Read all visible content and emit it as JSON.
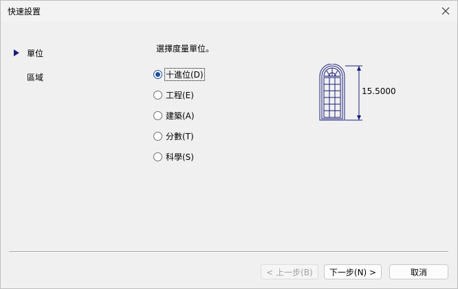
{
  "window": {
    "title": "快速設置"
  },
  "nav": {
    "items": [
      {
        "label": "單位",
        "active": true
      },
      {
        "label": "區域",
        "active": false
      }
    ]
  },
  "units": {
    "prompt": "選擇度量單位。",
    "options": [
      {
        "label": "十進位(D)",
        "checked": true
      },
      {
        "label": "工程(E)",
        "checked": false
      },
      {
        "label": "建築(A)",
        "checked": false
      },
      {
        "label": "分數(T)",
        "checked": false
      },
      {
        "label": "科學(S)",
        "checked": false
      }
    ],
    "preview_dimension": "15.5000"
  },
  "buttons": {
    "back_label": "< 上一步(B)",
    "next_label": "下一步(N) >",
    "cancel_label": "取消"
  },
  "colors": {
    "accent": "#1a4fa0",
    "window_bg": "#f0f0f0",
    "illustration": "#1b1f7a"
  },
  "icons": {
    "close": "close-icon",
    "nav_active": "triangle-right-icon",
    "preview": "arched-window-icon"
  }
}
